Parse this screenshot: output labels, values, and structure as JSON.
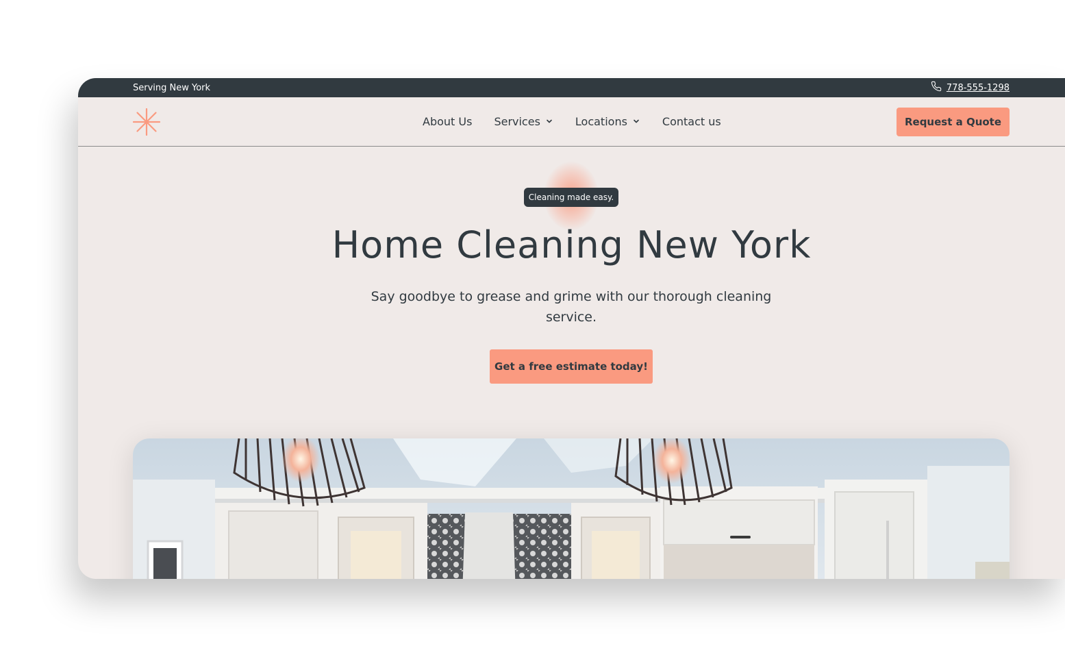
{
  "topbar": {
    "location_text": "Serving New York",
    "phone_icon": "phone-icon",
    "phone_number": "778-555-1298"
  },
  "nav": {
    "logo_icon": "asterisk-logo-icon",
    "items": [
      {
        "label": "About Us",
        "has_dropdown": false
      },
      {
        "label": "Services",
        "has_dropdown": true
      },
      {
        "label": "Locations",
        "has_dropdown": true
      },
      {
        "label": "Contact us",
        "has_dropdown": false
      }
    ],
    "quote_button": "Request a Quote"
  },
  "hero": {
    "badge": "Cleaning made easy.",
    "title": "Home Cleaning New York",
    "subtitle": "Say goodbye to grease and grime with our thorough cleaning service.",
    "cta": "Get a free estimate today!",
    "image_subject": "kitchen-photo"
  },
  "colors": {
    "dark": "#313a40",
    "accent": "#fa9a80",
    "background": "#f0eae8"
  }
}
